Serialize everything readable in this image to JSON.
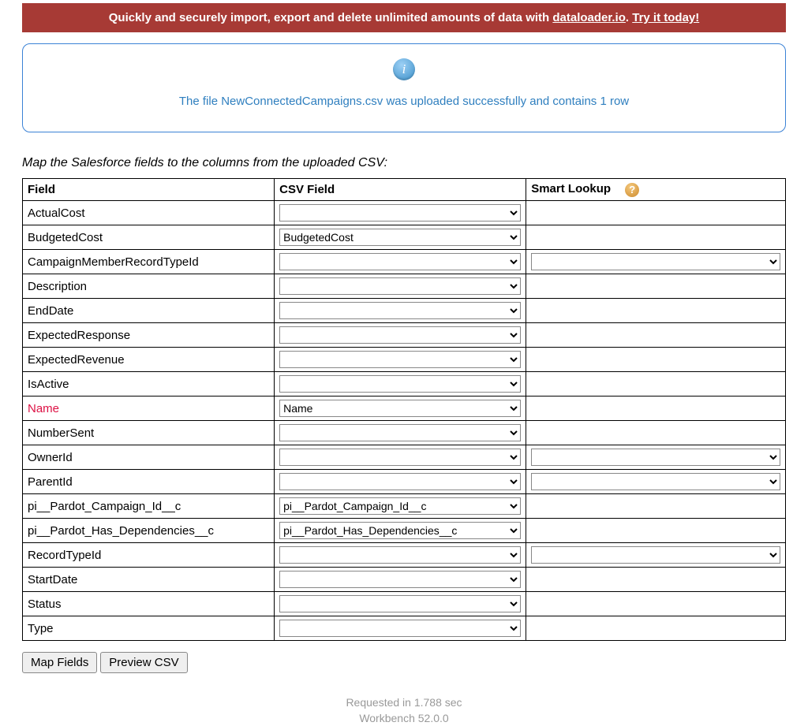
{
  "banner": {
    "prefix": "Quickly and securely import, export and delete unlimited amounts of data with ",
    "link1": "dataloader.io",
    "middle": ". ",
    "link2": "Try it today!"
  },
  "info": {
    "message": "The file NewConnectedCampaigns.csv was uploaded successfully and contains 1 row"
  },
  "instruction": "Map the Salesforce fields to the columns from the uploaded CSV:",
  "headers": {
    "field": "Field",
    "csv": "CSV Field",
    "smart": "Smart Lookup"
  },
  "rows": [
    {
      "field": "ActualCost",
      "csv": "",
      "smart": null,
      "required": false
    },
    {
      "field": "BudgetedCost",
      "csv": "BudgetedCost",
      "smart": null,
      "required": false
    },
    {
      "field": "CampaignMemberRecordTypeId",
      "csv": "",
      "smart": "",
      "required": false
    },
    {
      "field": "Description",
      "csv": "",
      "smart": null,
      "required": false
    },
    {
      "field": "EndDate",
      "csv": "",
      "smart": null,
      "required": false
    },
    {
      "field": "ExpectedResponse",
      "csv": "",
      "smart": null,
      "required": false
    },
    {
      "field": "ExpectedRevenue",
      "csv": "",
      "smart": null,
      "required": false
    },
    {
      "field": "IsActive",
      "csv": "",
      "smart": null,
      "required": false
    },
    {
      "field": "Name",
      "csv": "Name",
      "smart": null,
      "required": true
    },
    {
      "field": "NumberSent",
      "csv": "",
      "smart": null,
      "required": false
    },
    {
      "field": "OwnerId",
      "csv": "",
      "smart": "",
      "required": false
    },
    {
      "field": "ParentId",
      "csv": "",
      "smart": "",
      "required": false
    },
    {
      "field": "pi__Pardot_Campaign_Id__c",
      "csv": "pi__Pardot_Campaign_Id__c",
      "smart": null,
      "required": false
    },
    {
      "field": "pi__Pardot_Has_Dependencies__c",
      "csv": "pi__Pardot_Has_Dependencies__c",
      "smart": null,
      "required": false
    },
    {
      "field": "RecordTypeId",
      "csv": "",
      "smart": "",
      "required": false
    },
    {
      "field": "StartDate",
      "csv": "",
      "smart": null,
      "required": false
    },
    {
      "field": "Status",
      "csv": "",
      "smart": null,
      "required": false
    },
    {
      "field": "Type",
      "csv": "",
      "smart": null,
      "required": false
    }
  ],
  "buttons": {
    "map": "Map Fields",
    "preview": "Preview CSV"
  },
  "footer": {
    "line1": "Requested in 1.788 sec",
    "line2": "Workbench 52.0.0"
  }
}
